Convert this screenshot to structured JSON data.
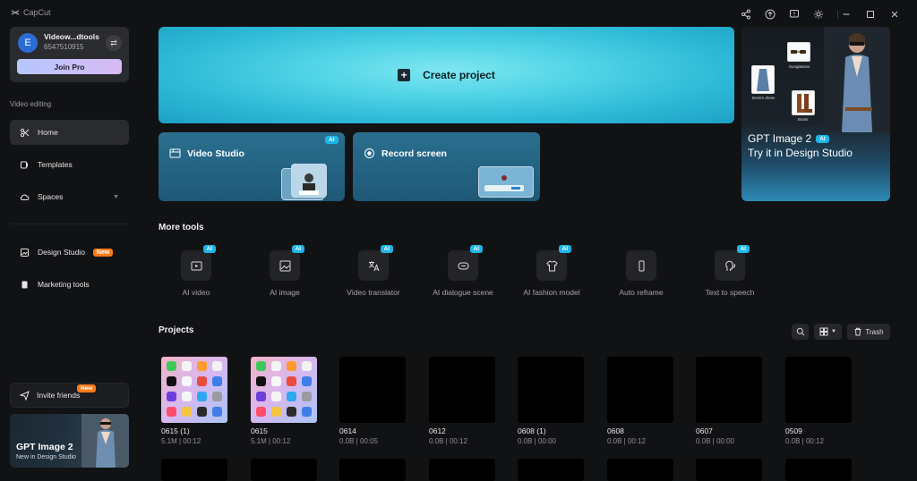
{
  "app": {
    "title": "CapCut"
  },
  "account": {
    "initial": "E",
    "name": "Videow...dtools",
    "id": "6547510915",
    "join_label": "Join Pro"
  },
  "sidebar": {
    "section_label": "Video editing",
    "items": [
      {
        "label": "Home",
        "icon": "home-icon",
        "active": true
      },
      {
        "label": "Templates",
        "icon": "templates-icon"
      },
      {
        "label": "Spaces",
        "icon": "cloud-icon"
      },
      {
        "label": "Design Studio",
        "icon": "design-icon",
        "badge": "New"
      },
      {
        "label": "Marketing tools",
        "icon": "marketing-icon"
      }
    ],
    "invite": {
      "label": "Invite friends",
      "badge": "New"
    },
    "promo": {
      "title": "GPT Image 2",
      "subtitle": "New in Design Studio"
    }
  },
  "main": {
    "create_label": "Create project",
    "cards": [
      {
        "label": "Video Studio",
        "tag": "AI"
      },
      {
        "label": "Record screen"
      }
    ],
    "promo": {
      "title": "GPT Image 2",
      "tag": "AI",
      "subtitle": "Try it in Design Studio",
      "product_labels": [
        "Sunglasses",
        "Denim dress",
        "Boots"
      ]
    },
    "more_tools_title": "More tools",
    "tools": [
      {
        "label": "AI video",
        "tag": "AI",
        "icon": "ai-video-icon"
      },
      {
        "label": "AI image",
        "tag": "AI",
        "icon": "ai-image-icon"
      },
      {
        "label": "Video translator",
        "tag": "AI",
        "icon": "translate-icon"
      },
      {
        "label": "AI dialogue scene",
        "tag": "AI",
        "icon": "dialogue-icon"
      },
      {
        "label": "AI fashion model",
        "tag": "AI",
        "icon": "fashion-icon"
      },
      {
        "label": "Auto reframe",
        "icon": "reframe-icon"
      },
      {
        "label": "Text to speech",
        "tag": "AI",
        "icon": "tts-icon"
      }
    ],
    "projects_title": "Projects",
    "trash_label": "Trash",
    "projects": [
      {
        "name": "0615 (1)",
        "meta": "5.1M | 00:12",
        "thumb": "phone"
      },
      {
        "name": "0615",
        "meta": "5.1M | 00:12",
        "thumb": "phone"
      },
      {
        "name": "0614",
        "meta": "0.0B | 00:05",
        "thumb": "black"
      },
      {
        "name": "0612",
        "meta": "0.0B | 00:12",
        "thumb": "black"
      },
      {
        "name": "0608 (1)",
        "meta": "0.0B | 00:00",
        "thumb": "black"
      },
      {
        "name": "0608",
        "meta": "0.0B | 00:12",
        "thumb": "black"
      },
      {
        "name": "0607",
        "meta": "0.0B | 00:00",
        "thumb": "black"
      },
      {
        "name": "0509",
        "meta": "0.0B | 00:12",
        "thumb": "black"
      }
    ]
  },
  "colors": {
    "accent": "#1fb5e8",
    "new_badge": "#ff7a1a",
    "background": "#111214"
  }
}
